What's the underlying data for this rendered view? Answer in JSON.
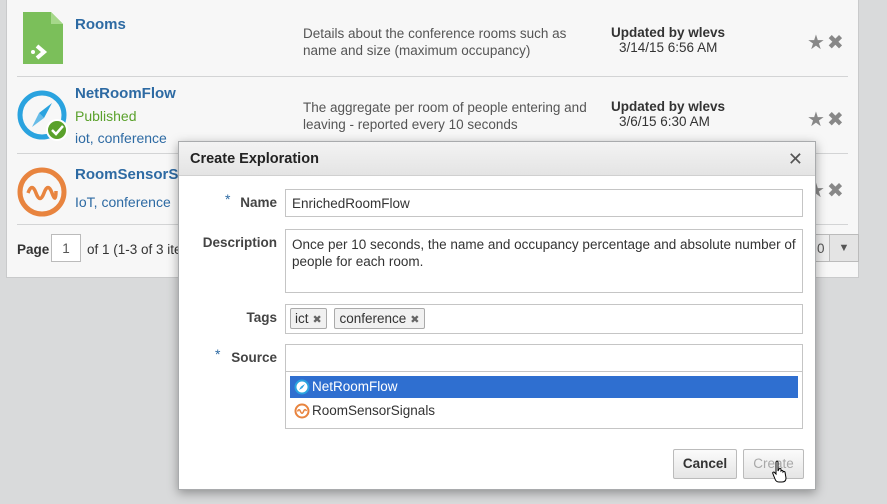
{
  "catalog": {
    "items": [
      {
        "title": "Rooms",
        "description": "Details about the conference rooms such as name and size (maximum occupancy)",
        "updated_by": "Updated by wlevs",
        "updated_at": "3/14/15 6:56 AM",
        "icon": "document-arrow-icon"
      },
      {
        "title": "NetRoomFlow",
        "status": "Published",
        "tags": "iot, conference",
        "description": "The aggregate per room of people entering and leaving - reported every 10 seconds",
        "updated_by": "Updated by wlevs",
        "updated_at": "3/6/15 6:30 AM",
        "icon": "compass-icon"
      },
      {
        "title": "RoomSensorS",
        "tags": "IoT, conference",
        "icon": "signal-wave-icon"
      }
    ],
    "pager": {
      "label": "Page",
      "page": "1",
      "of_text": "of 1 (1-3 of 3 ite",
      "partial_value": "0"
    }
  },
  "dialog": {
    "title": "Create Exploration",
    "required_mark": "*",
    "name_label": "Name",
    "name_value": "EnrichedRoomFlow",
    "description_label": "Description",
    "description_value": "Once per 10 seconds, the name and occupancy percentage and absolute number of people for each room.",
    "tags_label": "Tags",
    "tags": [
      "ict",
      "conference"
    ],
    "source_label": "Source",
    "source_value": "",
    "source_options": [
      "NetRoomFlow",
      "RoomSensorSignals"
    ],
    "cancel_label": "Cancel",
    "create_label": "Create"
  },
  "colors": {
    "link": "#2d6aa3",
    "published": "#5aa12b",
    "selection": "#2f6fd0",
    "compass": "#2aa3df",
    "sensor": "#e8843f",
    "doc": "#7bbf5a"
  }
}
